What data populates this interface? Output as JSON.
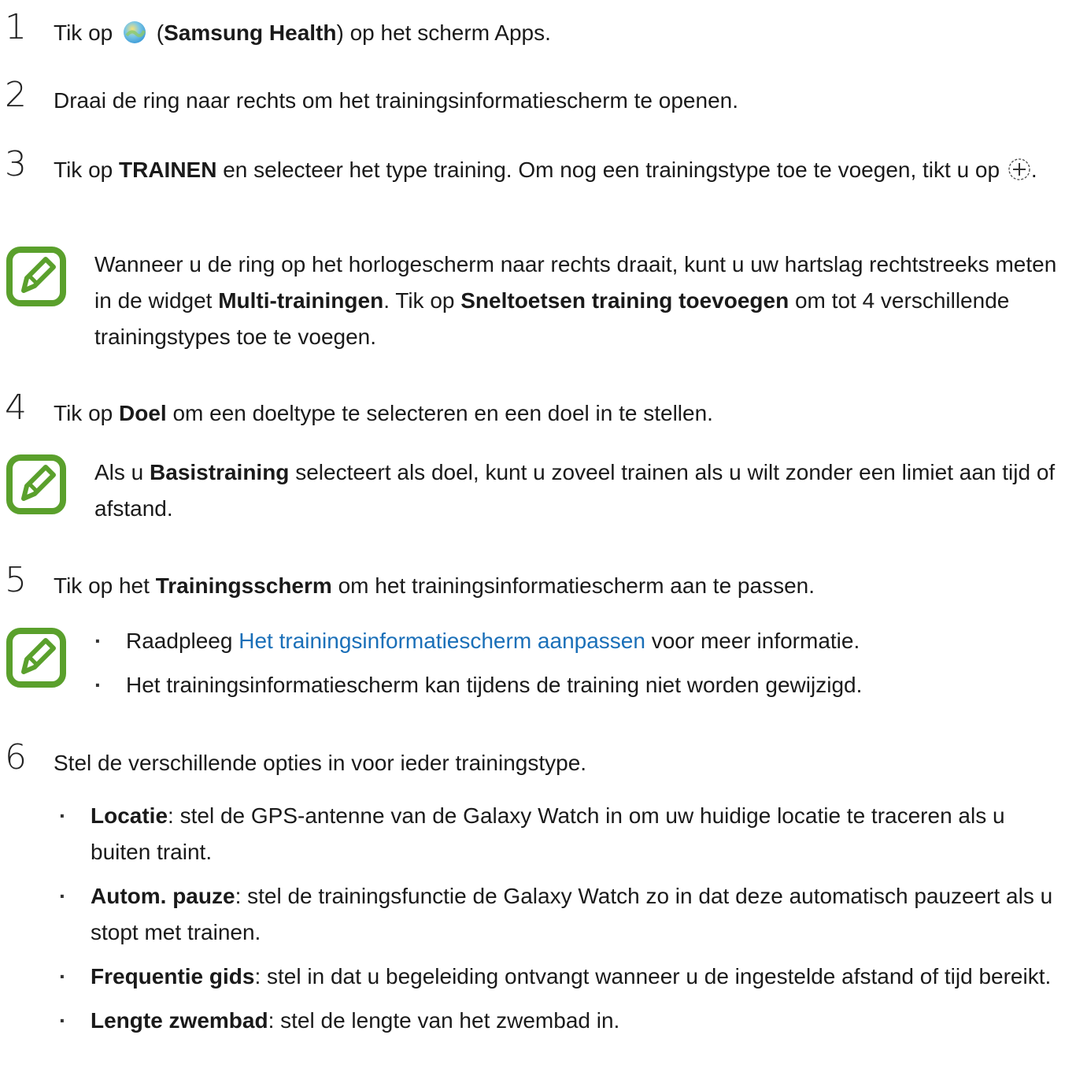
{
  "steps": [
    {
      "number": "1",
      "text_pre": "Tik op",
      "app_name_open": "(",
      "app_name": "Samsung Health",
      "app_name_close": ")",
      "text_post": "op het scherm Apps."
    },
    {
      "number": "2",
      "text": "Draai de ring naar rechts om het trainingsinformatiescherm te openen."
    },
    {
      "number": "3",
      "text_pre": "Tik op",
      "bold": "TRAINEN",
      "text_mid": "en selecteer het type training. Om nog een trainingstype toe te voegen, tikt u op",
      "text_post": "."
    },
    {
      "number": "4",
      "text_pre": "Tik op",
      "bold": "Doel",
      "text_post": "om een doeltype te selecteren en een doel in te stellen."
    },
    {
      "number": "5",
      "text_pre": "Tik op het",
      "bold": "Trainingsscherm",
      "text_post": "om het trainingsinformatiescherm aan te passen."
    },
    {
      "number": "6",
      "text": "Stel de verschillende opties in voor ieder trainingstype."
    }
  ],
  "notes": [
    {
      "p1": "Wanneer u de ring op het horlogescherm naar rechts draait, kunt u uw hartslag rechtstreeks meten in de widget",
      "b1": "Multi-trainingen",
      "p2": ". Tik op",
      "b2": "Sneltoetsen training toevoegen",
      "p3": "om tot 4 verschillende trainingstypes toe te voegen."
    },
    {
      "p1": "Als u",
      "b1": "Basistraining",
      "p2": "selecteert als doel, kunt u zoveel trainen als u wilt zonder een limiet aan tijd of afstand."
    },
    {
      "bullet1_pre": "Raadpleeg",
      "bullet1_link": "Het trainingsinformatiescherm aanpassen",
      "bullet1_post": "voor meer informatie.",
      "bullet2": "Het trainingsinformatiescherm kan tijdens de training niet worden gewijzigd."
    }
  ],
  "options": [
    {
      "label": "Locatie",
      "desc": ": stel de GPS-antenne van de Galaxy Watch in om uw huidige locatie te traceren als u buiten traint."
    },
    {
      "label": "Autom. pauze",
      "desc": ": stel de trainingsfunctie de Galaxy Watch zo in dat deze automatisch pauzeert als u stopt met trainen."
    },
    {
      "label": "Frequentie gids",
      "desc": ": stel in dat u begeleiding ontvangt wanneer u de ingestelde afstand of tijd bereikt."
    },
    {
      "label": "Lengte zwembad",
      "desc": ": stel de lengte van het zwembad in."
    }
  ],
  "icons": {
    "app": "samsung-health-app-icon",
    "add": "add-circle-icon",
    "note": "note-pencil-icon"
  },
  "colors": {
    "note_icon": "#5aa02c",
    "link": "#1a6fb8"
  }
}
